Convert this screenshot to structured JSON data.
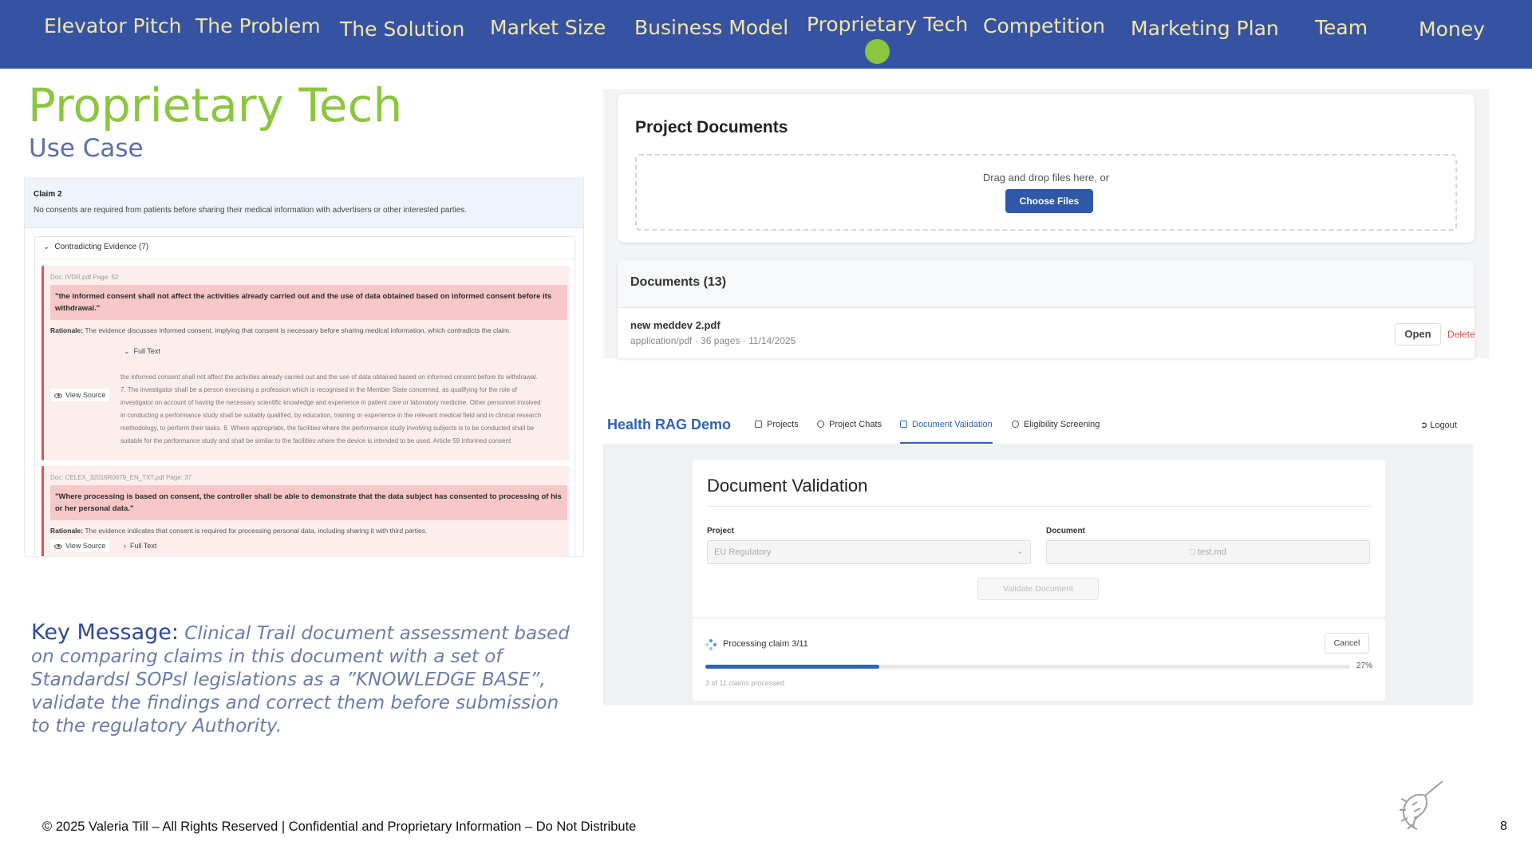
{
  "nav": {
    "items": [
      "Elevator Pitch",
      "The Problem",
      "The Solution",
      "Market Size",
      "Business Model",
      "Proprietary Tech",
      "Competition",
      "Marketing Plan",
      "Team",
      "Money"
    ],
    "active_index": 5
  },
  "slide": {
    "title": "Proprietary Tech",
    "subtitle": "Use Case"
  },
  "claim_panel": {
    "claim_title": "Claim 2",
    "claim_text": "No consents are required from patients before sharing their medical information with advertisers or other interested parties.",
    "evidence_toggle": "Contradicting Evidence (7)",
    "evidence": [
      {
        "doc_meta": "Doc: IVDR.pdf   Page: 52",
        "quote": "\"the informed consent shall not affect the activities already carried out and the use of data obtained based on informed consent before its withdrawal.\"",
        "rationale_label": "Rationale:",
        "rationale": "The evidence discusses informed consent, implying that consent is necessary before sharing medical information, which contradicts the claim.",
        "fulltext_label": "Full Text",
        "view_source": "View Source",
        "fulltext": "the informed consent shall not affect the activities already carried out and the use of data obtained based on informed consent before its withdrawal. 7. The investigator shall be a person exercising a profession which is recognised in the Member State concerned, as qualifying for the role of investigator on account of having the necessary scientific knowledge and experience in patient care or laboratory medicine. Other personnel involved in conducting a performance study shall be suitably qualified, by education, training or experience in the relevant medical field and in clinical research methodology, to perform their tasks. 8. Where appropriate, the facilities where the performance study involving subjects is to be conducted shall be suitable for the performance study and shall be similar to the facilities where the device is intended to be used. Article 59 Informed consent"
      },
      {
        "doc_meta": "Doc: CELEX_32016R0679_EN_TXT.pdf   Page: 37",
        "quote": "\"Where processing is based on consent, the controller shall be able to demonstrate that the data subject has consented to processing of his or her personal data.\"",
        "rationale_label": "Rationale:",
        "rationale": "The evidence indicates that consent is required for processing personal data, including sharing it with third parties.",
        "fulltext_label": "Full Text",
        "view_source": "View Source"
      }
    ]
  },
  "key_message": {
    "label": "Key Message:",
    "text": "Clinical Trail document assessment based on comparing claims in this document with a set of Standardsl SOPsl legislations as a ”KNOWLEDGE BASE”, validate the findings and correct them before submission to the regulatory Authority."
  },
  "project_docs": {
    "title": "Project Documents",
    "drop_text": "Drag and drop files here, or",
    "choose_button": "Choose Files",
    "docs_header": "Documents (13)",
    "doc_name": "new meddev 2.pdf",
    "doc_info": "application/pdf · 36 pages · 11/14/2025",
    "open_button": "Open",
    "delete_link": "Delete"
  },
  "rag_demo": {
    "brand": "Health RAG Demo",
    "tabs": [
      "Projects",
      "Project Chats",
      "Document Validation",
      "Eligibility Screening"
    ],
    "active_tab": "Document Validation",
    "logout": "Logout",
    "validation_title": "Document Validation",
    "project_label": "Project",
    "project_value": "EU Regulatory",
    "document_label": "Document",
    "document_value": "test.md",
    "validate_button": "Validate Document",
    "processing_text": "Processing claim 3/11",
    "cancel_button": "Cancel",
    "progress_percent_label": "27%",
    "progress_fraction": 0.27,
    "progress_sub": "3 of 11 claims processed"
  },
  "footer": {
    "copyright": "© 2025 Valeria Till – All Rights Reserved | Confidential and Proprietary Information – Do Not Distribute",
    "page_number": "8"
  },
  "colors": {
    "nav_bg": "#3653a3",
    "nav_text": "#f2e6a6",
    "accent_green": "#8cc63f",
    "brand_blue": "#2f63b3"
  }
}
